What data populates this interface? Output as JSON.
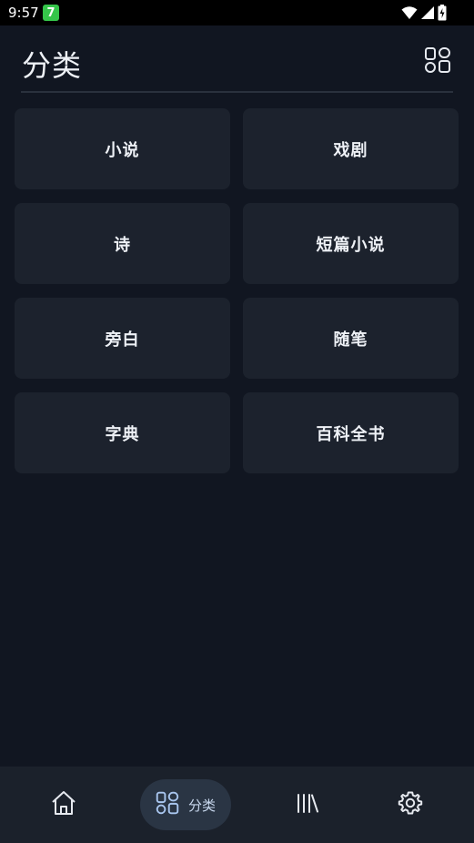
{
  "status_bar": {
    "time": "9:57",
    "app_badge": "7",
    "icons": [
      "wifi-icon",
      "signal-icon",
      "battery-charging-icon"
    ]
  },
  "header": {
    "title": "分类",
    "layout_icon": "grid-layout-icon"
  },
  "categories": [
    {
      "label": "小说"
    },
    {
      "label": "戏剧"
    },
    {
      "label": "诗"
    },
    {
      "label": "短篇小说"
    },
    {
      "label": "旁白"
    },
    {
      "label": "随笔"
    },
    {
      "label": "字典"
    },
    {
      "label": "百科全书"
    }
  ],
  "bottom_nav": {
    "items": [
      {
        "icon": "home-icon",
        "label": "",
        "active": false
      },
      {
        "icon": "category-grid-icon",
        "label": "分类",
        "active": true
      },
      {
        "icon": "library-icon",
        "label": "",
        "active": false
      },
      {
        "icon": "settings-gear-icon",
        "label": "",
        "active": false
      }
    ]
  },
  "colors": {
    "background": "#111621",
    "card": "#1c222d",
    "nav_background": "#1b212b",
    "nav_active_pill": "#2a3544",
    "nav_active_accent": "#a9c6ef",
    "app_badge": "#35c54a"
  }
}
